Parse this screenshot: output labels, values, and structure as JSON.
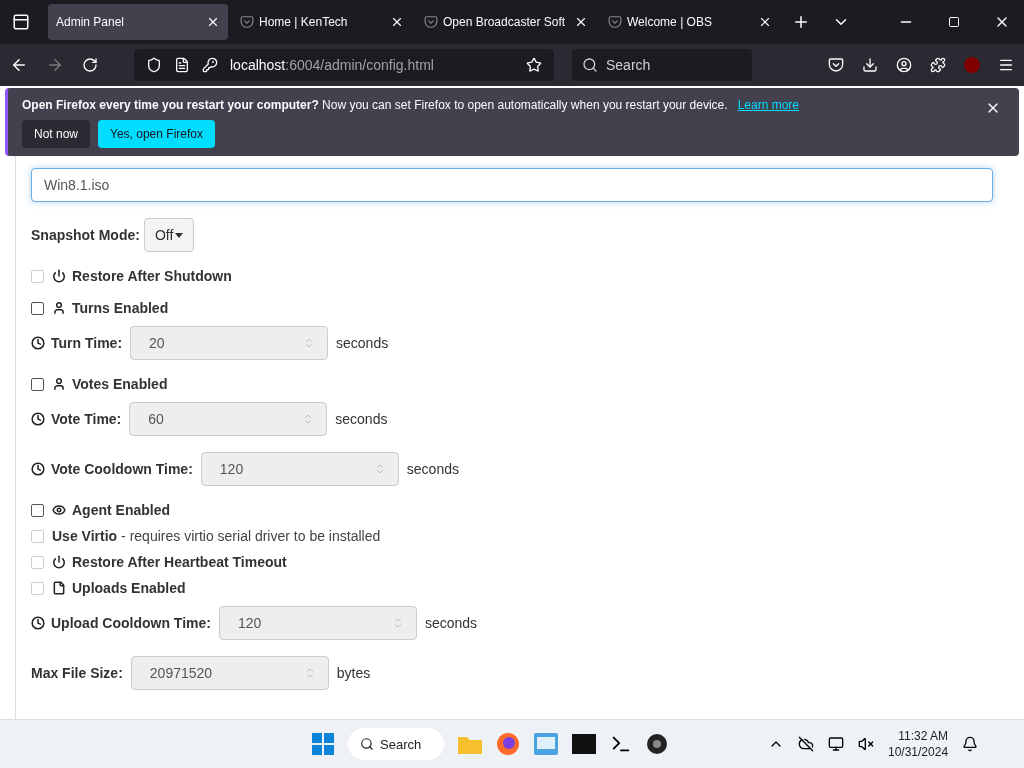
{
  "tabs": [
    {
      "label": "Admin Panel",
      "selected": true
    },
    {
      "label": "Home | KenTech",
      "selected": false
    },
    {
      "label": "Open Broadcaster Soft",
      "selected": false
    },
    {
      "label": "Welcome | OBS",
      "selected": false
    }
  ],
  "address": {
    "host": "localhost",
    "rest": ":6004/admin/config.html"
  },
  "search": {
    "placeholder": "Search"
  },
  "notification": {
    "text": "**Open Firefox every time you restart your computer?** Now you can set Firefox to open automatically when you restart your device.",
    "link": "Learn more",
    "buttons": [
      {
        "label": "Not now",
        "kind": "secondary"
      },
      {
        "label": "Yes, open Firefox",
        "kind": "primary"
      }
    ]
  },
  "form": [
    {
      "items": [
        {
          "kind": "text",
          "value": "Win8.1.iso"
        }
      ]
    },
    {
      "items": [
        {
          "kind": "dropdown",
          "label": "Snapshot Mode:",
          "value": "Off"
        }
      ]
    },
    {
      "items": [
        {
          "kind": "checkbox",
          "label": "Restore After Shutdown",
          "checked": false,
          "disabled": true
        }
      ]
    },
    {
      "items": [
        {
          "kind": "checkbox",
          "label": "Turns Enabled",
          "checked": false,
          "disabled": false
        },
        {
          "kind": "number",
          "label": "Turn Time:",
          "value": "20",
          "unit": "seconds"
        }
      ]
    },
    {
      "items": [
        {
          "kind": "checkbox",
          "label": "Votes Enabled",
          "checked": false,
          "disabled": false
        },
        {
          "kind": "number",
          "label": "Vote Time:",
          "value": "60",
          "unit": "seconds"
        }
      ]
    },
    {
      "items": [
        {
          "kind": "number",
          "label": "Vote Cooldown Time:",
          "value": "120",
          "unit": "seconds"
        }
      ]
    },
    {
      "items": [
        {
          "kind": "checkbox",
          "label": "Agent Enabled",
          "checked": false,
          "disabled": false
        },
        {
          "kind": "checkbox",
          "label": "Use Virtio",
          "note": "- requires virtio serial driver to be installed",
          "checked": false,
          "disabled": true
        },
        {
          "kind": "checkbox",
          "label": "Restore After Heartbeat Timeout",
          "checked": false,
          "disabled": true
        },
        {
          "kind": "checkbox",
          "label": "Uploads Enabled",
          "checked": false,
          "disabled": true
        },
        {
          "kind": "number",
          "label": "Upload Cooldown Time:",
          "value": "120",
          "unit": "seconds"
        }
      ]
    },
    {
      "items": [
        {
          "kind": "number",
          "label": "Max File Size:",
          "value": "20971520",
          "unit": "bytes"
        }
      ]
    }
  ],
  "taskbar": {
    "search": "Search",
    "time": "11:32 AM",
    "date": "10/31/2024"
  }
}
